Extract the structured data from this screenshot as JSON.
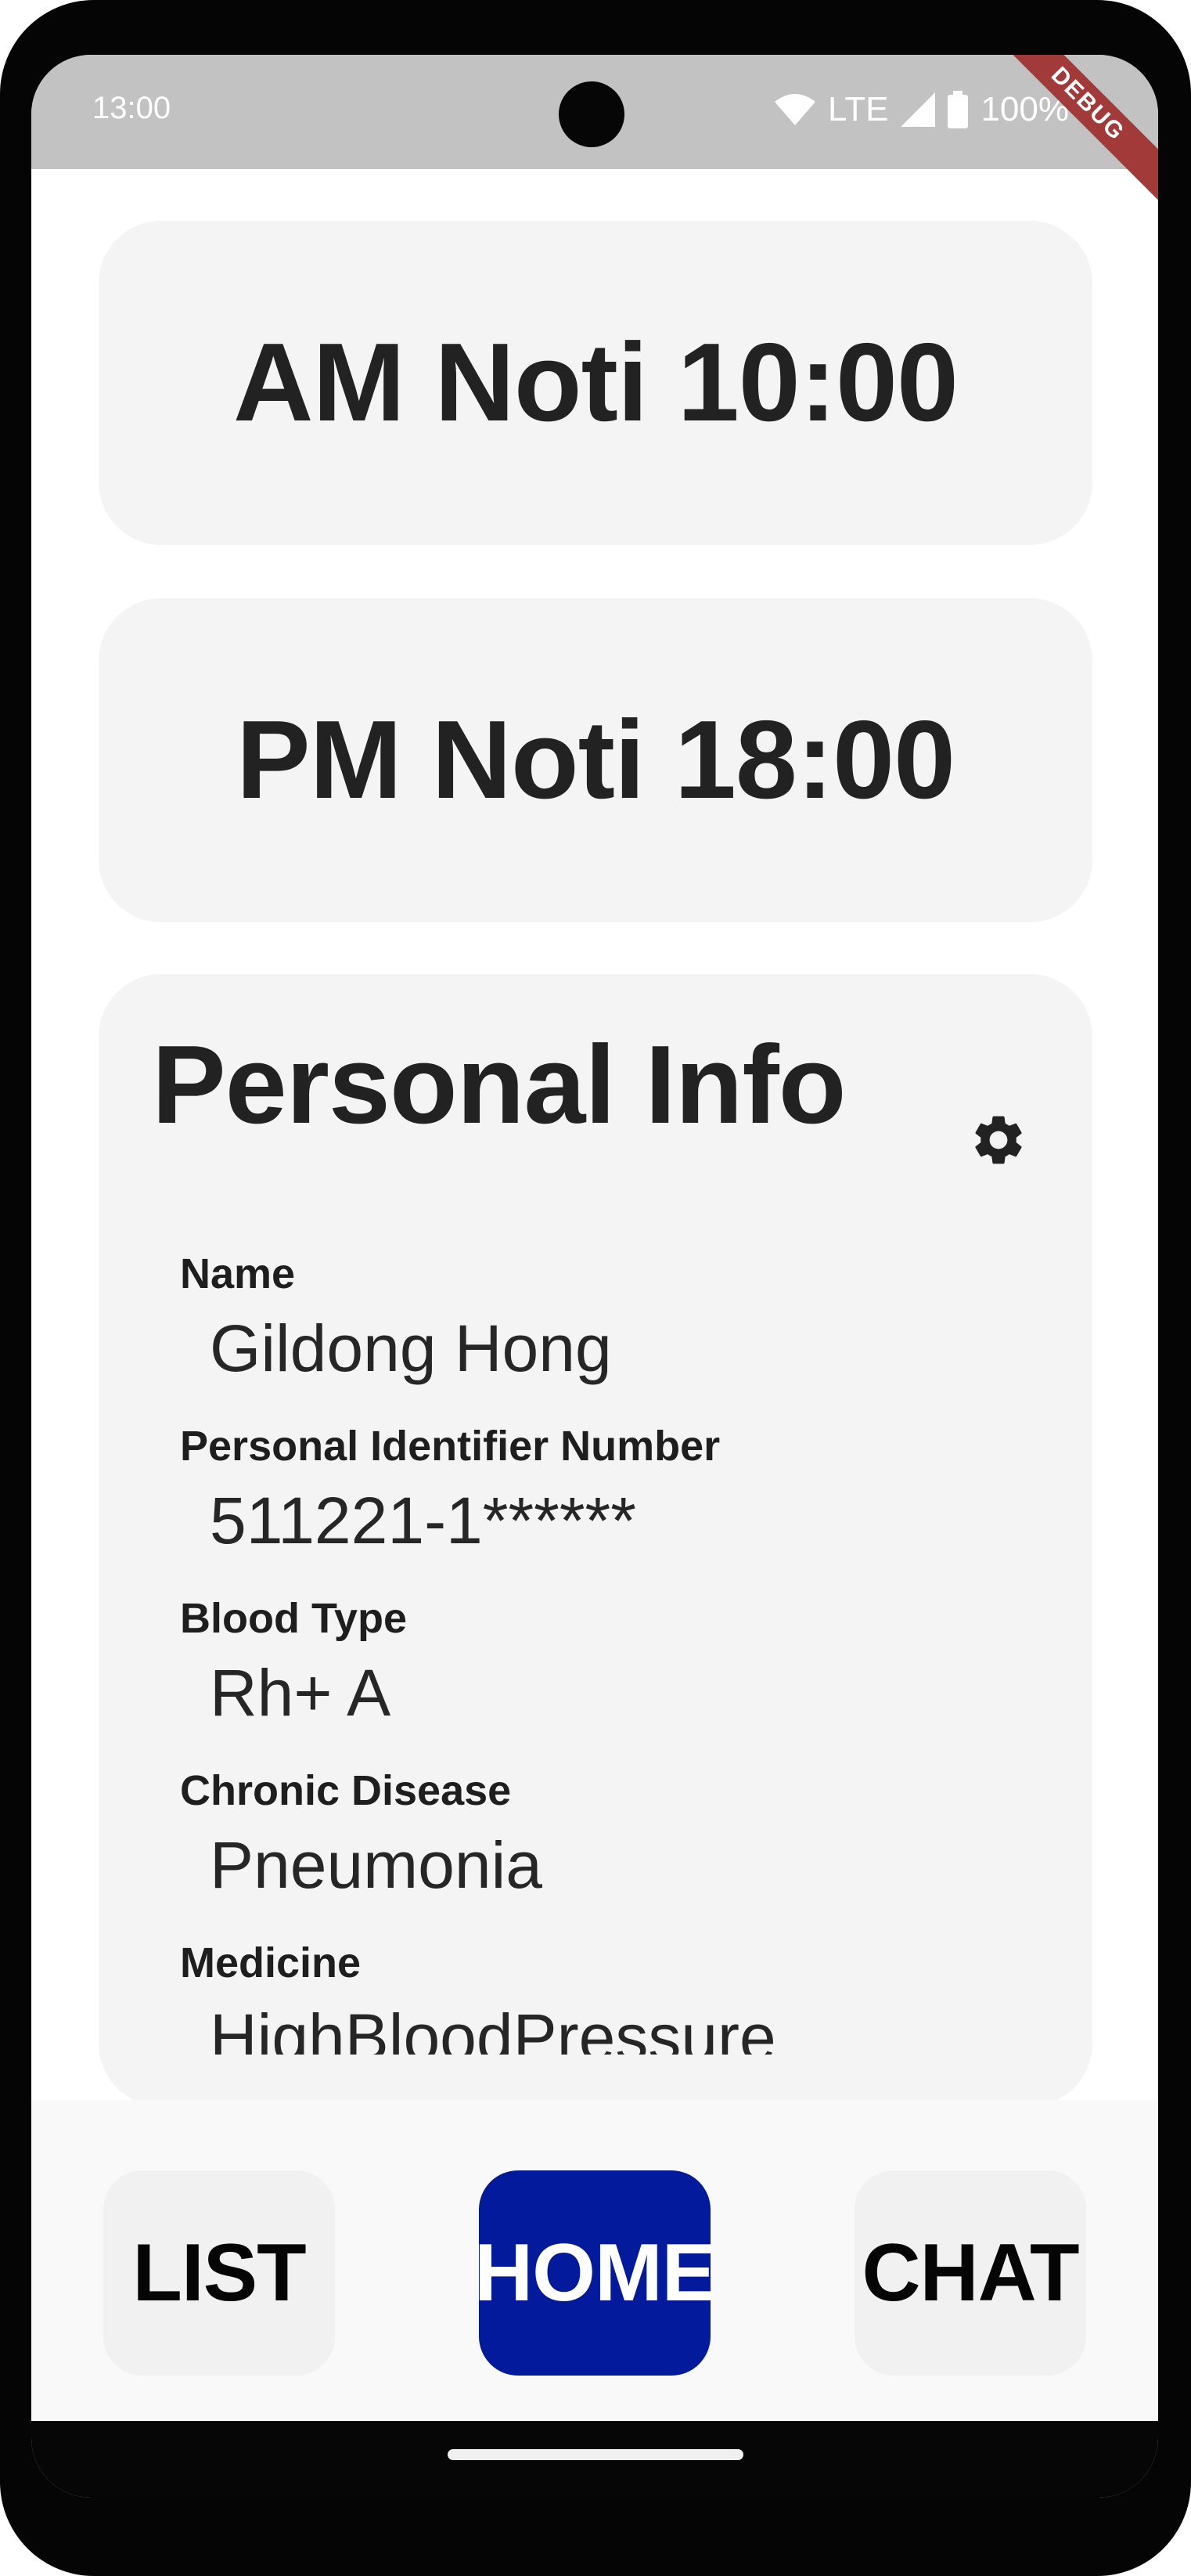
{
  "status_bar": {
    "time": "13:00",
    "network": "LTE",
    "battery": "100%",
    "debug_banner": "DEBUG",
    "icons": [
      "wifi-icon",
      "signal-icon",
      "battery-icon"
    ]
  },
  "notifications": {
    "am": "AM Noti 10:00",
    "pm": "PM Noti 18:00"
  },
  "personal_info": {
    "title": "Personal Info",
    "settings_icon": "gear-icon",
    "fields": [
      {
        "label": "Name",
        "value": "Gildong Hong"
      },
      {
        "label": "Personal Identifier Number",
        "value": "511221-1******"
      },
      {
        "label": "Blood Type",
        "value": "Rh+ A"
      },
      {
        "label": "Chronic Disease",
        "value": "Pneumonia"
      },
      {
        "label": "Medicine",
        "value": "HighBloodPressure"
      }
    ]
  },
  "bottom_nav": {
    "list": "LIST",
    "home": "HOME",
    "chat": "CHAT",
    "active": "HOME",
    "active_color": "#031a9c"
  }
}
